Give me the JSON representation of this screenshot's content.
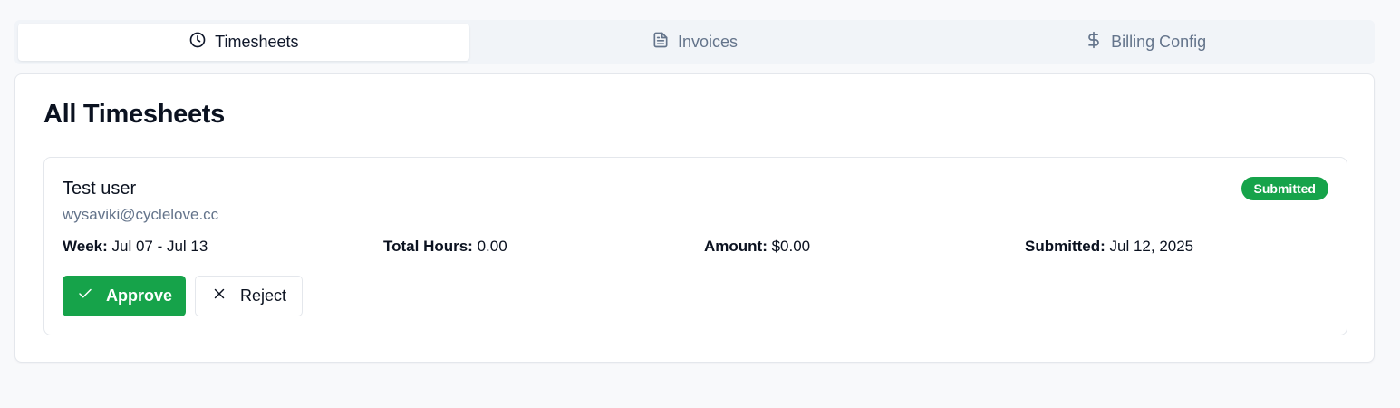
{
  "tabs": [
    {
      "label": "Timesheets",
      "icon": "clock-icon",
      "active": true
    },
    {
      "label": "Invoices",
      "icon": "document-icon",
      "active": false
    },
    {
      "label": "Billing Config",
      "icon": "dollar-icon",
      "active": false
    }
  ],
  "panel": {
    "title": "All Timesheets"
  },
  "timesheet": {
    "user_name": "Test user",
    "email": "wysaviki@cyclelove.cc",
    "status": "Submitted",
    "status_color": "#16a34a",
    "week_label": "Week:",
    "week_value": " Jul 07 - Jul 13",
    "hours_label": "Total Hours:",
    "hours_value": " 0.00",
    "amount_label": "Amount:",
    "amount_value": " $0.00",
    "submitted_label": "Submitted:",
    "submitted_value": " Jul 12, 2025",
    "approve_label": "Approve",
    "reject_label": "Reject"
  },
  "colors": {
    "accent_green": "#16a34a",
    "muted_text": "#64748b"
  }
}
